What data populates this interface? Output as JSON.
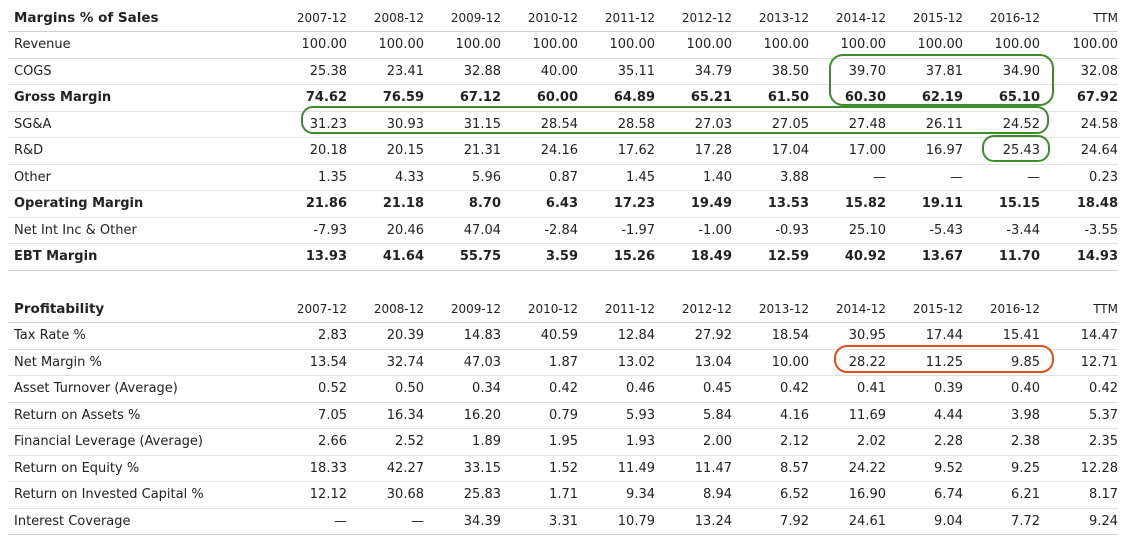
{
  "years": [
    "2007-12",
    "2008-12",
    "2009-12",
    "2010-12",
    "2011-12",
    "2012-12",
    "2013-12",
    "2014-12",
    "2015-12",
    "2016-12",
    "TTM"
  ],
  "margins": {
    "title": "Margins % of Sales",
    "rows": [
      {
        "label": "Revenue",
        "bold": false,
        "values": [
          "100.00",
          "100.00",
          "100.00",
          "100.00",
          "100.00",
          "100.00",
          "100.00",
          "100.00",
          "100.00",
          "100.00",
          "100.00"
        ]
      },
      {
        "label": "COGS",
        "bold": false,
        "values": [
          "25.38",
          "23.41",
          "32.88",
          "40.00",
          "35.11",
          "34.79",
          "38.50",
          "39.70",
          "37.81",
          "34.90",
          "32.08"
        ]
      },
      {
        "label": "Gross Margin",
        "bold": true,
        "values": [
          "74.62",
          "76.59",
          "67.12",
          "60.00",
          "64.89",
          "65.21",
          "61.50",
          "60.30",
          "62.19",
          "65.10",
          "67.92"
        ]
      },
      {
        "label": "SG&A",
        "bold": false,
        "values": [
          "31.23",
          "30.93",
          "31.15",
          "28.54",
          "28.58",
          "27.03",
          "27.05",
          "27.48",
          "26.11",
          "24.52",
          "24.58"
        ]
      },
      {
        "label": "R&D",
        "bold": false,
        "values": [
          "20.18",
          "20.15",
          "21.31",
          "24.16",
          "17.62",
          "17.28",
          "17.04",
          "17.00",
          "16.97",
          "25.43",
          "24.64"
        ]
      },
      {
        "label": "Other",
        "bold": false,
        "values": [
          "1.35",
          "4.33",
          "5.96",
          "0.87",
          "1.45",
          "1.40",
          "3.88",
          "—",
          "—",
          "—",
          "0.23"
        ]
      },
      {
        "label": "Operating Margin",
        "bold": true,
        "values": [
          "21.86",
          "21.18",
          "8.70",
          "6.43",
          "17.23",
          "19.49",
          "13.53",
          "15.82",
          "19.11",
          "15.15",
          "18.48"
        ]
      },
      {
        "label": "Net Int Inc & Other",
        "bold": false,
        "values": [
          "-7.93",
          "20.46",
          "47.04",
          "-2.84",
          "-1.97",
          "-1.00",
          "-0.93",
          "25.10",
          "-5.43",
          "-3.44",
          "-3.55"
        ]
      },
      {
        "label": "EBT Margin",
        "bold": true,
        "values": [
          "13.93",
          "41.64",
          "55.75",
          "3.59",
          "15.26",
          "18.49",
          "12.59",
          "40.92",
          "13.67",
          "11.70",
          "14.93"
        ]
      }
    ]
  },
  "profitability": {
    "title": "Profitability",
    "rows": [
      {
        "label": "Tax Rate %",
        "bold": false,
        "values": [
          "2.83",
          "20.39",
          "14.83",
          "40.59",
          "12.84",
          "27.92",
          "18.54",
          "30.95",
          "17.44",
          "15.41",
          "14.47"
        ]
      },
      {
        "label": "Net Margin %",
        "bold": false,
        "values": [
          "13.54",
          "32.74",
          "47.03",
          "1.87",
          "13.02",
          "13.04",
          "10.00",
          "28.22",
          "11.25",
          "9.85",
          "12.71"
        ]
      },
      {
        "label": "Asset Turnover (Average)",
        "bold": false,
        "values": [
          "0.52",
          "0.50",
          "0.34",
          "0.42",
          "0.46",
          "0.45",
          "0.42",
          "0.41",
          "0.39",
          "0.40",
          "0.42"
        ]
      },
      {
        "label": "Return on Assets %",
        "bold": false,
        "values": [
          "7.05",
          "16.34",
          "16.20",
          "0.79",
          "5.93",
          "5.84",
          "4.16",
          "11.69",
          "4.44",
          "3.98",
          "5.37"
        ]
      },
      {
        "label": "Financial Leverage (Average)",
        "bold": false,
        "values": [
          "2.66",
          "2.52",
          "1.89",
          "1.95",
          "1.93",
          "2.00",
          "2.12",
          "2.02",
          "2.28",
          "2.38",
          "2.35"
        ]
      },
      {
        "label": "Return on Equity %",
        "bold": false,
        "values": [
          "18.33",
          "42.27",
          "33.15",
          "1.52",
          "11.49",
          "11.47",
          "8.57",
          "24.22",
          "9.52",
          "9.25",
          "12.28"
        ]
      },
      {
        "label": "Return on Invested Capital %",
        "bold": false,
        "values": [
          "12.12",
          "30.68",
          "25.83",
          "1.71",
          "9.34",
          "8.94",
          "6.52",
          "16.90",
          "6.74",
          "6.21",
          "8.17"
        ]
      },
      {
        "label": "Interest Coverage",
        "bold": false,
        "values": [
          "—",
          "—",
          "34.39",
          "3.31",
          "10.79",
          "13.24",
          "7.92",
          "24.61",
          "9.04",
          "7.72",
          "9.24"
        ]
      }
    ]
  },
  "highlight_colors": {
    "green": "#3f8a2a",
    "orange": "#e0501a"
  }
}
